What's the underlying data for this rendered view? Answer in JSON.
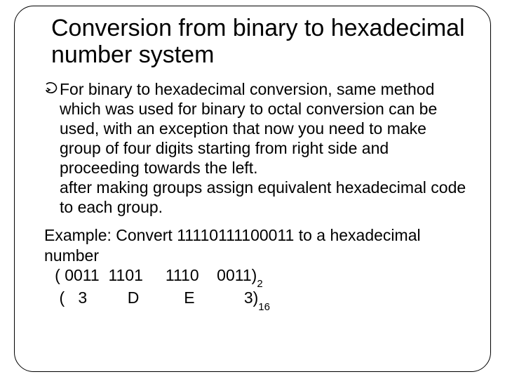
{
  "title": "Conversion from binary to hexadecimal number system",
  "bullet": {
    "text": "For binary to hexadecimal conversion, same method which was used for binary to octal conversion can be used, with an exception that now you need to make group of four digits starting from right side and proceeding towards the left.",
    "text2": " after making groups assign equivalent hexadecimal code to each group."
  },
  "example": {
    "prompt": "Example: Convert 11110111100011 to a hexadecimal number",
    "binary_line": "   ( 0011  1101     1110    0011)",
    "binary_sub": "2",
    "hex_line": "    (   3         D          E           3)",
    "hex_sub": "16"
  }
}
